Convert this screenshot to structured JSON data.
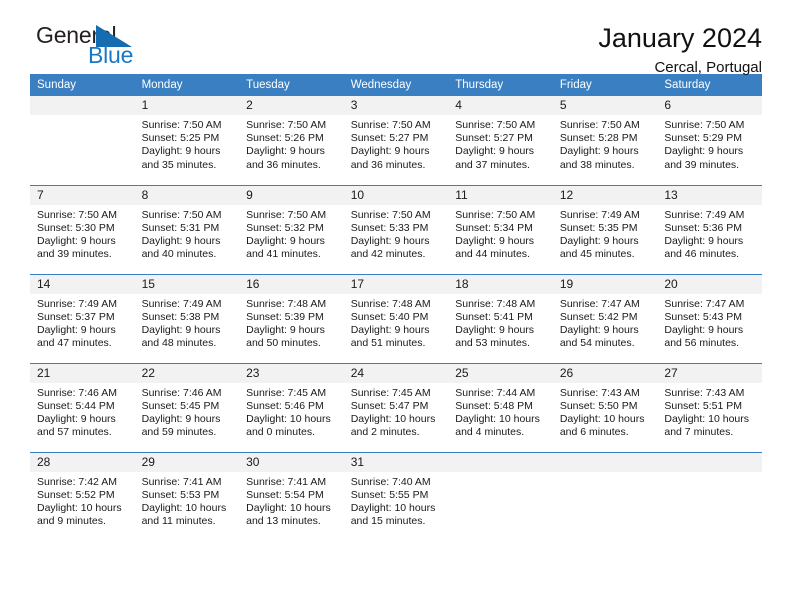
{
  "logo": {
    "word_one": "General",
    "word_two": "Blue",
    "triangle_color": "#156cb0",
    "blue_color": "#1878c8"
  },
  "title": {
    "month_year": "January 2024",
    "location": "Cercal, Portugal"
  },
  "theme": {
    "header_blue": "#3a7fc1",
    "daynum_band": "#f2f2f2"
  },
  "calendar": {
    "weekday_headers": [
      "Sunday",
      "Monday",
      "Tuesday",
      "Wednesday",
      "Thursday",
      "Friday",
      "Saturday"
    ],
    "weeks": [
      [
        {
          "day": "",
          "sunrise": "",
          "sunset": "",
          "daylight_line1": "",
          "daylight_line2": ""
        },
        {
          "day": "1",
          "sunrise": "Sunrise: 7:50 AM",
          "sunset": "Sunset: 5:25 PM",
          "daylight_line1": "Daylight: 9 hours",
          "daylight_line2": "and 35 minutes."
        },
        {
          "day": "2",
          "sunrise": "Sunrise: 7:50 AM",
          "sunset": "Sunset: 5:26 PM",
          "daylight_line1": "Daylight: 9 hours",
          "daylight_line2": "and 36 minutes."
        },
        {
          "day": "3",
          "sunrise": "Sunrise: 7:50 AM",
          "sunset": "Sunset: 5:27 PM",
          "daylight_line1": "Daylight: 9 hours",
          "daylight_line2": "and 36 minutes."
        },
        {
          "day": "4",
          "sunrise": "Sunrise: 7:50 AM",
          "sunset": "Sunset: 5:27 PM",
          "daylight_line1": "Daylight: 9 hours",
          "daylight_line2": "and 37 minutes."
        },
        {
          "day": "5",
          "sunrise": "Sunrise: 7:50 AM",
          "sunset": "Sunset: 5:28 PM",
          "daylight_line1": "Daylight: 9 hours",
          "daylight_line2": "and 38 minutes."
        },
        {
          "day": "6",
          "sunrise": "Sunrise: 7:50 AM",
          "sunset": "Sunset: 5:29 PM",
          "daylight_line1": "Daylight: 9 hours",
          "daylight_line2": "and 39 minutes."
        }
      ],
      [
        {
          "day": "7",
          "sunrise": "Sunrise: 7:50 AM",
          "sunset": "Sunset: 5:30 PM",
          "daylight_line1": "Daylight: 9 hours",
          "daylight_line2": "and 39 minutes."
        },
        {
          "day": "8",
          "sunrise": "Sunrise: 7:50 AM",
          "sunset": "Sunset: 5:31 PM",
          "daylight_line1": "Daylight: 9 hours",
          "daylight_line2": "and 40 minutes."
        },
        {
          "day": "9",
          "sunrise": "Sunrise: 7:50 AM",
          "sunset": "Sunset: 5:32 PM",
          "daylight_line1": "Daylight: 9 hours",
          "daylight_line2": "and 41 minutes."
        },
        {
          "day": "10",
          "sunrise": "Sunrise: 7:50 AM",
          "sunset": "Sunset: 5:33 PM",
          "daylight_line1": "Daylight: 9 hours",
          "daylight_line2": "and 42 minutes."
        },
        {
          "day": "11",
          "sunrise": "Sunrise: 7:50 AM",
          "sunset": "Sunset: 5:34 PM",
          "daylight_line1": "Daylight: 9 hours",
          "daylight_line2": "and 44 minutes."
        },
        {
          "day": "12",
          "sunrise": "Sunrise: 7:49 AM",
          "sunset": "Sunset: 5:35 PM",
          "daylight_line1": "Daylight: 9 hours",
          "daylight_line2": "and 45 minutes."
        },
        {
          "day": "13",
          "sunrise": "Sunrise: 7:49 AM",
          "sunset": "Sunset: 5:36 PM",
          "daylight_line1": "Daylight: 9 hours",
          "daylight_line2": "and 46 minutes."
        }
      ],
      [
        {
          "day": "14",
          "sunrise": "Sunrise: 7:49 AM",
          "sunset": "Sunset: 5:37 PM",
          "daylight_line1": "Daylight: 9 hours",
          "daylight_line2": "and 47 minutes."
        },
        {
          "day": "15",
          "sunrise": "Sunrise: 7:49 AM",
          "sunset": "Sunset: 5:38 PM",
          "daylight_line1": "Daylight: 9 hours",
          "daylight_line2": "and 48 minutes."
        },
        {
          "day": "16",
          "sunrise": "Sunrise: 7:48 AM",
          "sunset": "Sunset: 5:39 PM",
          "daylight_line1": "Daylight: 9 hours",
          "daylight_line2": "and 50 minutes."
        },
        {
          "day": "17",
          "sunrise": "Sunrise: 7:48 AM",
          "sunset": "Sunset: 5:40 PM",
          "daylight_line1": "Daylight: 9 hours",
          "daylight_line2": "and 51 minutes."
        },
        {
          "day": "18",
          "sunrise": "Sunrise: 7:48 AM",
          "sunset": "Sunset: 5:41 PM",
          "daylight_line1": "Daylight: 9 hours",
          "daylight_line2": "and 53 minutes."
        },
        {
          "day": "19",
          "sunrise": "Sunrise: 7:47 AM",
          "sunset": "Sunset: 5:42 PM",
          "daylight_line1": "Daylight: 9 hours",
          "daylight_line2": "and 54 minutes."
        },
        {
          "day": "20",
          "sunrise": "Sunrise: 7:47 AM",
          "sunset": "Sunset: 5:43 PM",
          "daylight_line1": "Daylight: 9 hours",
          "daylight_line2": "and 56 minutes."
        }
      ],
      [
        {
          "day": "21",
          "sunrise": "Sunrise: 7:46 AM",
          "sunset": "Sunset: 5:44 PM",
          "daylight_line1": "Daylight: 9 hours",
          "daylight_line2": "and 57 minutes."
        },
        {
          "day": "22",
          "sunrise": "Sunrise: 7:46 AM",
          "sunset": "Sunset: 5:45 PM",
          "daylight_line1": "Daylight: 9 hours",
          "daylight_line2": "and 59 minutes."
        },
        {
          "day": "23",
          "sunrise": "Sunrise: 7:45 AM",
          "sunset": "Sunset: 5:46 PM",
          "daylight_line1": "Daylight: 10 hours",
          "daylight_line2": "and 0 minutes."
        },
        {
          "day": "24",
          "sunrise": "Sunrise: 7:45 AM",
          "sunset": "Sunset: 5:47 PM",
          "daylight_line1": "Daylight: 10 hours",
          "daylight_line2": "and 2 minutes."
        },
        {
          "day": "25",
          "sunrise": "Sunrise: 7:44 AM",
          "sunset": "Sunset: 5:48 PM",
          "daylight_line1": "Daylight: 10 hours",
          "daylight_line2": "and 4 minutes."
        },
        {
          "day": "26",
          "sunrise": "Sunrise: 7:43 AM",
          "sunset": "Sunset: 5:50 PM",
          "daylight_line1": "Daylight: 10 hours",
          "daylight_line2": "and 6 minutes."
        },
        {
          "day": "27",
          "sunrise": "Sunrise: 7:43 AM",
          "sunset": "Sunset: 5:51 PM",
          "daylight_line1": "Daylight: 10 hours",
          "daylight_line2": "and 7 minutes."
        }
      ],
      [
        {
          "day": "28",
          "sunrise": "Sunrise: 7:42 AM",
          "sunset": "Sunset: 5:52 PM",
          "daylight_line1": "Daylight: 10 hours",
          "daylight_line2": "and 9 minutes."
        },
        {
          "day": "29",
          "sunrise": "Sunrise: 7:41 AM",
          "sunset": "Sunset: 5:53 PM",
          "daylight_line1": "Daylight: 10 hours",
          "daylight_line2": "and 11 minutes."
        },
        {
          "day": "30",
          "sunrise": "Sunrise: 7:41 AM",
          "sunset": "Sunset: 5:54 PM",
          "daylight_line1": "Daylight: 10 hours",
          "daylight_line2": "and 13 minutes."
        },
        {
          "day": "31",
          "sunrise": "Sunrise: 7:40 AM",
          "sunset": "Sunset: 5:55 PM",
          "daylight_line1": "Daylight: 10 hours",
          "daylight_line2": "and 15 minutes."
        },
        {
          "day": "",
          "sunrise": "",
          "sunset": "",
          "daylight_line1": "",
          "daylight_line2": ""
        },
        {
          "day": "",
          "sunrise": "",
          "sunset": "",
          "daylight_line1": "",
          "daylight_line2": ""
        },
        {
          "day": "",
          "sunrise": "",
          "sunset": "",
          "daylight_line1": "",
          "daylight_line2": ""
        }
      ]
    ]
  }
}
